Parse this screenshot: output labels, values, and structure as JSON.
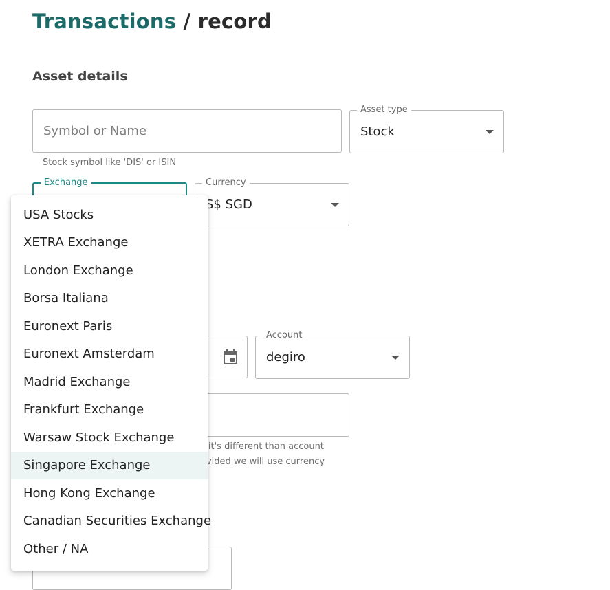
{
  "header": {
    "breadcrumb_parent": "Transactions",
    "separator": " / ",
    "current_page": "record"
  },
  "asset_details": {
    "section_title": "Asset details",
    "symbol": {
      "placeholder": "Symbol or Name",
      "helper": "Stock symbol like 'DIS' or ISIN"
    },
    "asset_type": {
      "label": "Asset type",
      "value": "Stock"
    },
    "exchange": {
      "label": "Exchange",
      "value": ""
    },
    "currency": {
      "label": "Currency",
      "value": "S$ SGD"
    }
  },
  "transaction": {
    "account": {
      "label": "Account",
      "value": "degiro"
    },
    "date_icon": "calendar-icon",
    "helper_line1": "s it's different than account",
    "helper_line2": "ovided we will use currency"
  },
  "exchange_menu": {
    "selected_index": 9,
    "options": [
      "USA Stocks",
      "XETRA Exchange",
      "London Exchange",
      "Borsa Italiana",
      "Euronext Paris",
      "Euronext Amsterdam",
      "Madrid Exchange",
      "Frankfurt Exchange",
      "Warsaw Stock Exchange",
      "Singapore Exchange",
      "Hong Kong Exchange",
      "Canadian Securities Exchange",
      "Other / NA"
    ]
  },
  "colors": {
    "brand": "#1c6b69",
    "focus": "#1c8a86",
    "selected_bg": "#edf5f4"
  }
}
